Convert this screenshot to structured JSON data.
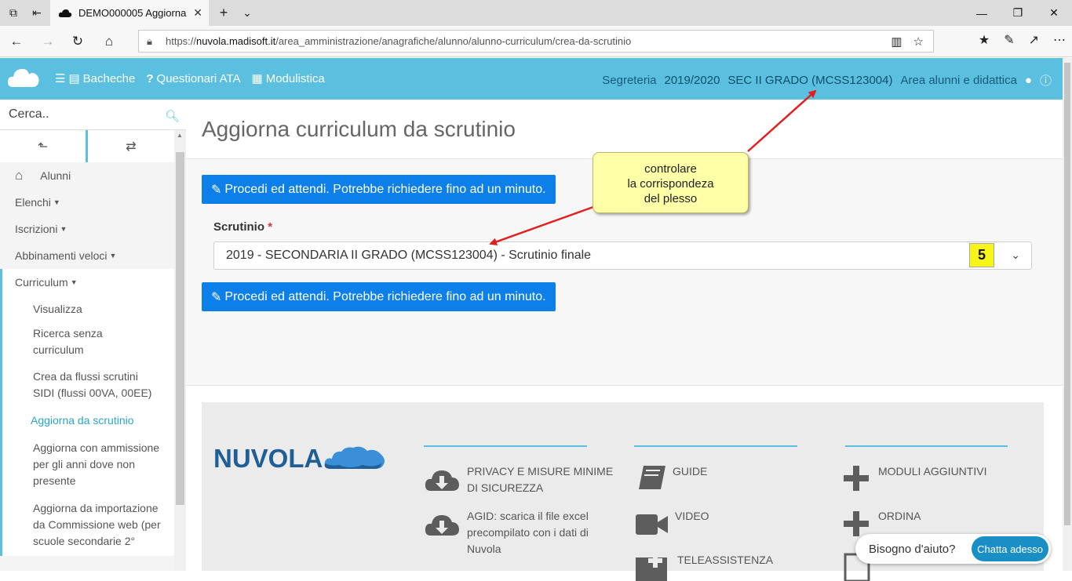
{
  "browser": {
    "tab_title": "DEMO000005 Aggiorna",
    "url_prefix": "https://",
    "url_host": "nuvola.madisoft.it",
    "url_path": "/area_amministrazione/anagrafiche/alunno/alunno-curriculum/crea-da-scrutinio"
  },
  "header": {
    "nav": [
      {
        "icon": "menu-icon",
        "label": "Bacheche"
      },
      {
        "icon": "question-icon",
        "label": "Questionari ATA"
      },
      {
        "icon": "clipboard-icon",
        "label": "Modulistica"
      }
    ],
    "role": "Segreteria",
    "year": "2019/2020",
    "school": "SEC II GRADO (MCSS123004)",
    "area": "Area alunni e didattica"
  },
  "sidebar": {
    "search_placeholder": "Cerca..",
    "menu": {
      "alunni": "Alunni",
      "elenchi": "Elenchi",
      "iscrizioni": "Iscrizioni",
      "abbinamenti": "Abbinamenti veloci",
      "curriculum": "Curriculum",
      "visualizza": "Visualizza",
      "ricerca": "Ricerca senza curriculum",
      "crea_flussi": "Crea da flussi scrutini SIDI (flussi 00VA, 00EE)",
      "aggiorna_scrutinio": "Aggiorna da scrutinio",
      "aggiorna_ammissione": "Aggiorna con ammissione per gli anni dove non presente",
      "aggiorna_importazione": "Aggiorna da importazione da Commissione web (per scuole secondarie 2°"
    }
  },
  "main": {
    "title": "Aggiorna curriculum da scrutinio",
    "proceed_button": "Procedi ed attendi. Potrebbe richiedere fino ad un minuto.",
    "scrutinio_label": "Scrutinio",
    "required_mark": "*",
    "scrutinio_value": "2019 - SECONDARIA II GRADO (MCSS123004) - Scrutinio finale",
    "step_badge": "5"
  },
  "callout": {
    "line1": "controlare",
    "line2": "la corrispondeza",
    "line3": "del plesso"
  },
  "footer": {
    "logo_text": "NUVOLA",
    "col1": [
      "PRIVACY E MISURE MINIME DI SICUREZZA",
      "AGID: scarica il file excel precompilato con i dati di Nuvola"
    ],
    "col2": [
      "GUIDE",
      "VIDEO",
      "TELEASSISTENZA"
    ],
    "col3": [
      "MODULI AGGIUNTIVI",
      "ORDINA"
    ]
  },
  "chat": {
    "prompt": "Bisogno d'aiuto?",
    "button": "Chatta adesso"
  },
  "colors": {
    "header": "#5bbfe0",
    "button": "#0d7fe8",
    "callout": "#ffffa8",
    "arrow": "#e02020"
  }
}
